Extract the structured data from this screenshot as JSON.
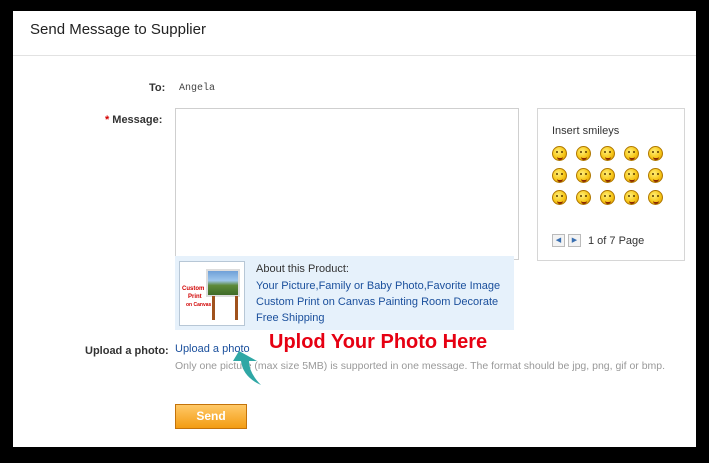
{
  "form": {
    "title": "Send Message to Supplier",
    "to_label": "To:",
    "to_value": "Angela",
    "required_mark": "*",
    "message_label": "Message:",
    "upload_label": "Upload a photo:",
    "upload_link": "Upload a photo",
    "upload_note": "Only one picture (max size 5MB) is supported in one message. The format should be jpg, png, gif or bmp.",
    "send_label": "Send"
  },
  "smileys": {
    "title": "Insert smileys",
    "icons": [
      "smile",
      "laugh",
      "wink",
      "grin",
      "cry",
      "angry",
      "tongue",
      "sweat",
      "cool",
      "sleepy",
      "shy",
      "blush",
      "big-grin",
      "confused",
      "love"
    ],
    "pager_text": "1 of 7 Page"
  },
  "product": {
    "about_label": "About this Product:",
    "lines": [
      "Your Picture,Family or Baby Photo,Favorite Image",
      "Custom Print on Canvas Painting Room Decorate",
      "Free Shipping"
    ],
    "thumb_text_1": "Custom",
    "thumb_text_2": "Print",
    "thumb_text_3": "on Canvas"
  },
  "overlay": {
    "text": "Uplod Your Photo Here",
    "color": "#e60012"
  },
  "colors": {
    "link": "#1a4f9c",
    "send_button": "#f39c12",
    "product_bg": "#e6f1fb"
  }
}
